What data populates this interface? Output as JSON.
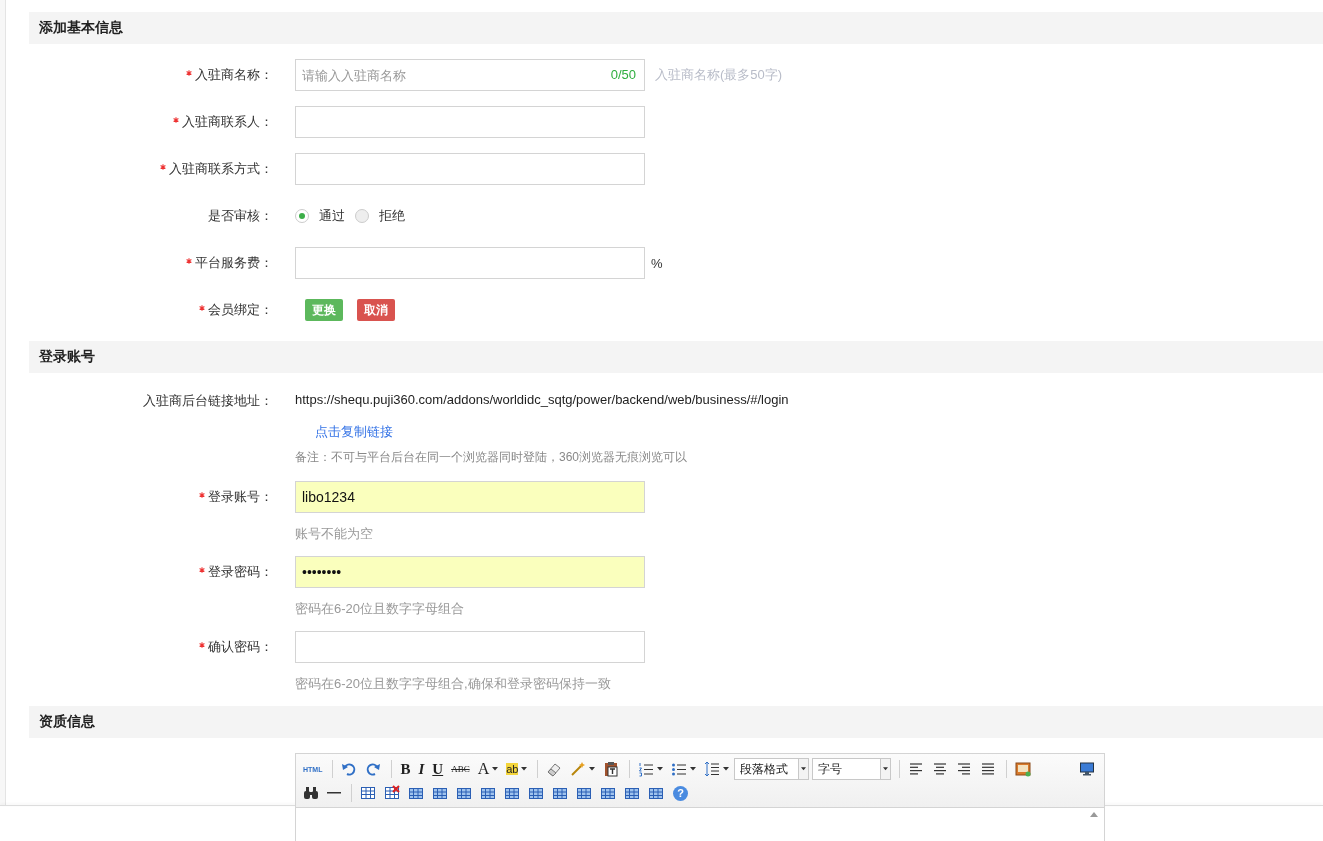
{
  "sections": [
    {
      "title": "添加基本信息",
      "rows": [
        {
          "kind": "input",
          "required": true,
          "label": "入驻商名称：",
          "placeholder": "请输入入驻商名称",
          "counter": "0/50",
          "hint": "入驻商名称(最多50字)"
        },
        {
          "kind": "input",
          "required": true,
          "label": "入驻商联系人："
        },
        {
          "kind": "input",
          "required": true,
          "label": "入驻商联系方式："
        },
        {
          "kind": "radio",
          "required": false,
          "label": "是否审核：",
          "options": [
            {
              "label": "通过",
              "selected": true
            },
            {
              "label": "拒绝",
              "selected": false
            }
          ]
        },
        {
          "kind": "input",
          "required": true,
          "label": "平台服务费：",
          "suffix": "%"
        },
        {
          "kind": "buttons",
          "required": true,
          "label": "会员绑定：",
          "buttons": [
            {
              "label": "更换",
              "kind": "success"
            },
            {
              "label": "取消",
              "kind": "danger"
            }
          ]
        }
      ]
    },
    {
      "title": "登录账号",
      "rows": [
        {
          "kind": "link",
          "required": false,
          "label": "入驻商后台链接地址：",
          "value": "https://shequ.puji360.com/addons/worldidc_sqtg/power/backend/web/business/#/login",
          "link": "点击复制链接",
          "note": "备注：不可与平台后台在同一个浏览器同时登陆，360浏览器无痕浏览可以"
        },
        {
          "kind": "input",
          "required": true,
          "label": "登录账号：",
          "value": "libo1234",
          "autofilled": true,
          "help": "账号不能为空"
        },
        {
          "kind": "input",
          "required": true,
          "label": "登录密码：",
          "value": "••••••••",
          "autofilled": true,
          "help": "密码在6-20位且数字字母组合"
        },
        {
          "kind": "input",
          "required": true,
          "label": "确认密码：",
          "help": "密码在6-20位且数字字母组合,确保和登录密码保持一致"
        }
      ]
    },
    {
      "title": "资质信息"
    }
  ],
  "editor": {
    "toolbar": [
      [
        {
          "kind": "html",
          "label": "HTML"
        },
        {
          "kind": "sep"
        },
        {
          "kind": "undo"
        },
        {
          "kind": "redo"
        },
        {
          "kind": "sep"
        },
        {
          "kind": "bold",
          "label": "B"
        },
        {
          "kind": "italic",
          "label": "I"
        },
        {
          "kind": "underline",
          "label": "U"
        },
        {
          "kind": "strike",
          "label": "ABC"
        },
        {
          "kind": "fontcolor",
          "label": "A",
          "caret": true
        },
        {
          "kind": "highlight",
          "label": "ab",
          "caret": true
        },
        {
          "kind": "sep"
        },
        {
          "kind": "eraser"
        },
        {
          "kind": "wand",
          "caret": true
        },
        {
          "kind": "paste"
        },
        {
          "kind": "sep"
        },
        {
          "kind": "olist",
          "caret": true
        },
        {
          "kind": "ulist",
          "caret": true
        },
        {
          "kind": "lineheight",
          "caret": true
        },
        {
          "kind": "select",
          "label": "段落格式"
        },
        {
          "kind": "select",
          "label": "字号"
        },
        {
          "kind": "sep"
        },
        {
          "kind": "alignleft"
        },
        {
          "kind": "aligncenter"
        },
        {
          "kind": "alignright"
        },
        {
          "kind": "justify"
        },
        {
          "kind": "sep"
        },
        {
          "kind": "image"
        },
        {
          "kind": "spacer"
        },
        {
          "kind": "preview"
        }
      ],
      [
        {
          "kind": "find"
        },
        {
          "kind": "hr"
        },
        {
          "kind": "sep"
        },
        {
          "kind": "table"
        },
        {
          "kind": "tabledelete"
        },
        {
          "kind": "tableop"
        },
        {
          "kind": "tableop"
        },
        {
          "kind": "tableop"
        },
        {
          "kind": "tableop"
        },
        {
          "kind": "tableop"
        },
        {
          "kind": "tableop"
        },
        {
          "kind": "tableop"
        },
        {
          "kind": "tableop"
        },
        {
          "kind": "tableop"
        },
        {
          "kind": "tableop"
        },
        {
          "kind": "tableop"
        },
        {
          "kind": "help",
          "label": "?"
        }
      ]
    ]
  }
}
